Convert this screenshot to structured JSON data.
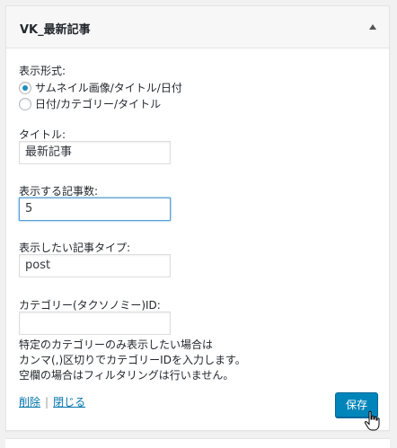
{
  "widget": {
    "title": "VK_最新記事",
    "toggle_icon": "triangle-up"
  },
  "display_format": {
    "label": "表示形式:",
    "options": [
      {
        "label": "サムネイル画像/タイトル/日付",
        "checked": true
      },
      {
        "label": "日付/カテゴリー/タイトル",
        "checked": false
      }
    ]
  },
  "title_field": {
    "label": "タイトル:",
    "value": "最新記事"
  },
  "count_field": {
    "label": "表示する記事数:",
    "value": "5"
  },
  "post_type_field": {
    "label": "表示したい記事タイプ:",
    "value": "post"
  },
  "category_field": {
    "label": "カテゴリー(タクソノミー)ID:",
    "value": ""
  },
  "help_text": [
    "特定のカテゴリーのみ表示したい場合は",
    "カンマ(,)区切りでカテゴリーIDを入力します。",
    "空欄の場合はフィルタリングは行いません。"
  ],
  "actions": {
    "delete_label": "削除",
    "separator": "|",
    "close_label": "閉じる",
    "save_label": "保存"
  },
  "colors": {
    "accent": "#0085ba",
    "link": "#0073aa"
  }
}
